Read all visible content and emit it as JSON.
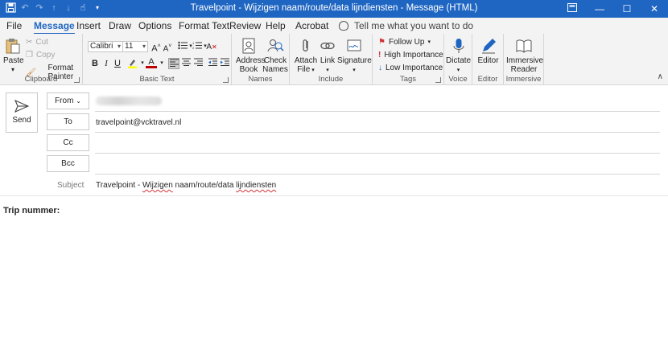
{
  "window": {
    "title": "Travelpoint - Wijzigen naam/route/data lijndiensten - Message (HTML)",
    "controls": [
      "restore-ribbon",
      "minimize",
      "maximize",
      "close"
    ]
  },
  "tabs": [
    "File",
    "Message",
    "Insert",
    "Draw",
    "Options",
    "Format Text",
    "Review",
    "Help",
    "Acrobat"
  ],
  "active_tab": "Message",
  "tell_me": "Tell me what you want to do",
  "ribbon": {
    "clipboard": {
      "label": "Clipboard",
      "paste": "Paste",
      "cut": "Cut",
      "copy": "Copy",
      "format_painter": "Format Painter"
    },
    "basic_text": {
      "label": "Basic Text",
      "font": "Calibri",
      "size": "11",
      "bold": "B",
      "italic": "I",
      "underline": "U"
    },
    "names": {
      "label": "Names",
      "address_book_1": "Address",
      "address_book_2": "Book",
      "check_names_1": "Check",
      "check_names_2": "Names"
    },
    "include": {
      "label": "Include",
      "attach_1": "Attach",
      "attach_2": "File",
      "link": "Link",
      "signature": "Signature"
    },
    "tags": {
      "label": "Tags",
      "follow_up": "Follow Up",
      "high": "High Importance",
      "low": "Low Importance"
    },
    "voice": {
      "label": "Voice",
      "dictate": "Dictate"
    },
    "editor": {
      "label": "Editor",
      "editor": "Editor"
    },
    "immersive": {
      "label": "Immersive",
      "reader_1": "Immersive",
      "reader_2": "Reader"
    }
  },
  "compose": {
    "send": "Send",
    "from": "From",
    "to": "To",
    "cc": "Cc",
    "bcc": "Bcc",
    "to_value": "travelpoint@vcktravel.nl",
    "subject_label": "Subject",
    "subject_a": "Travelpoint - ",
    "subject_b": "Wijzigen",
    "subject_c": " naam/route/data ",
    "subject_d": "lijndiensten",
    "body": "Trip nummer:"
  },
  "colors": {
    "accent": "#1f66c2",
    "highlight": "#ffff00",
    "font_color": "#c00000",
    "flag": "#d13438",
    "spell": "#d13438"
  }
}
